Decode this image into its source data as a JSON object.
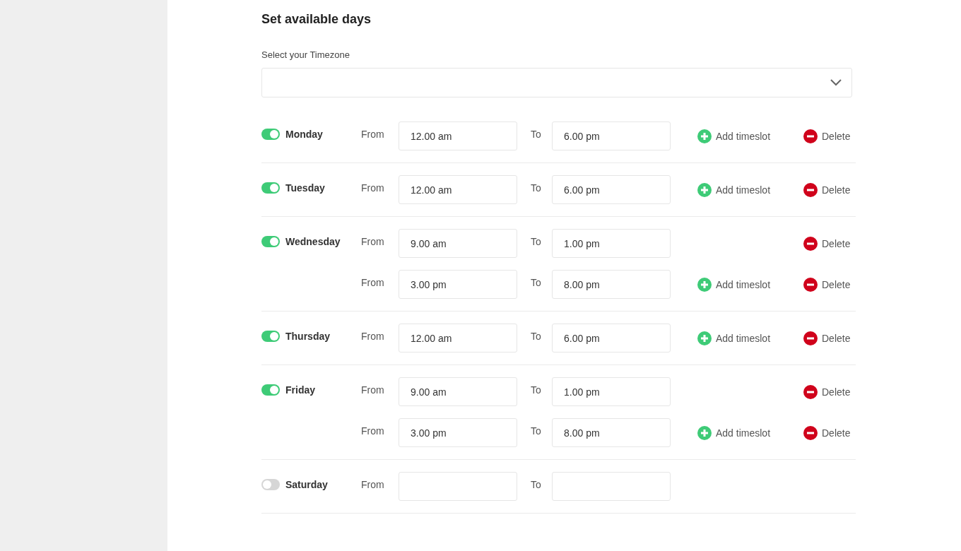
{
  "title": "Set available days",
  "timezone": {
    "label": "Select your Timezone"
  },
  "days": [
    {
      "name": "Monday",
      "enabled": true,
      "slots": [
        {
          "from_label": "From",
          "from": "12.00 am",
          "to_label": "To",
          "to": "6.00 pm",
          "add": "Add timeslot",
          "delete": "Delete"
        }
      ]
    },
    {
      "name": "Tuesday",
      "enabled": true,
      "slots": [
        {
          "from_label": "From",
          "from": "12.00 am",
          "to_label": "To",
          "to": "6.00 pm",
          "add": "Add timeslot",
          "delete": "Delete"
        }
      ]
    },
    {
      "name": "Wednesday",
      "enabled": true,
      "slots": [
        {
          "from_label": "From",
          "from": "9.00 am",
          "to_label": "To",
          "to": "1.00 pm",
          "delete": "Delete"
        },
        {
          "from_label": "From",
          "from": "3.00 pm",
          "to_label": "To",
          "to": "8.00 pm",
          "add": "Add timeslot",
          "delete": "Delete"
        }
      ]
    },
    {
      "name": "Thursday",
      "enabled": true,
      "slots": [
        {
          "from_label": "From",
          "from": "12.00 am",
          "to_label": "To",
          "to": "6.00 pm",
          "add": "Add timeslot",
          "delete": "Delete"
        }
      ]
    },
    {
      "name": "Friday",
      "enabled": true,
      "slots": [
        {
          "from_label": "From",
          "from": "9.00 am",
          "to_label": "To",
          "to": "1.00 pm",
          "delete": "Delete"
        },
        {
          "from_label": "From",
          "from": "3.00 pm",
          "to_label": "To",
          "to": "8.00 pm",
          "add": "Add timeslot",
          "delete": "Delete"
        }
      ]
    },
    {
      "name": "Saturday",
      "enabled": false,
      "slots": [
        {
          "from_label": "From",
          "to_label": "To"
        }
      ]
    }
  ]
}
